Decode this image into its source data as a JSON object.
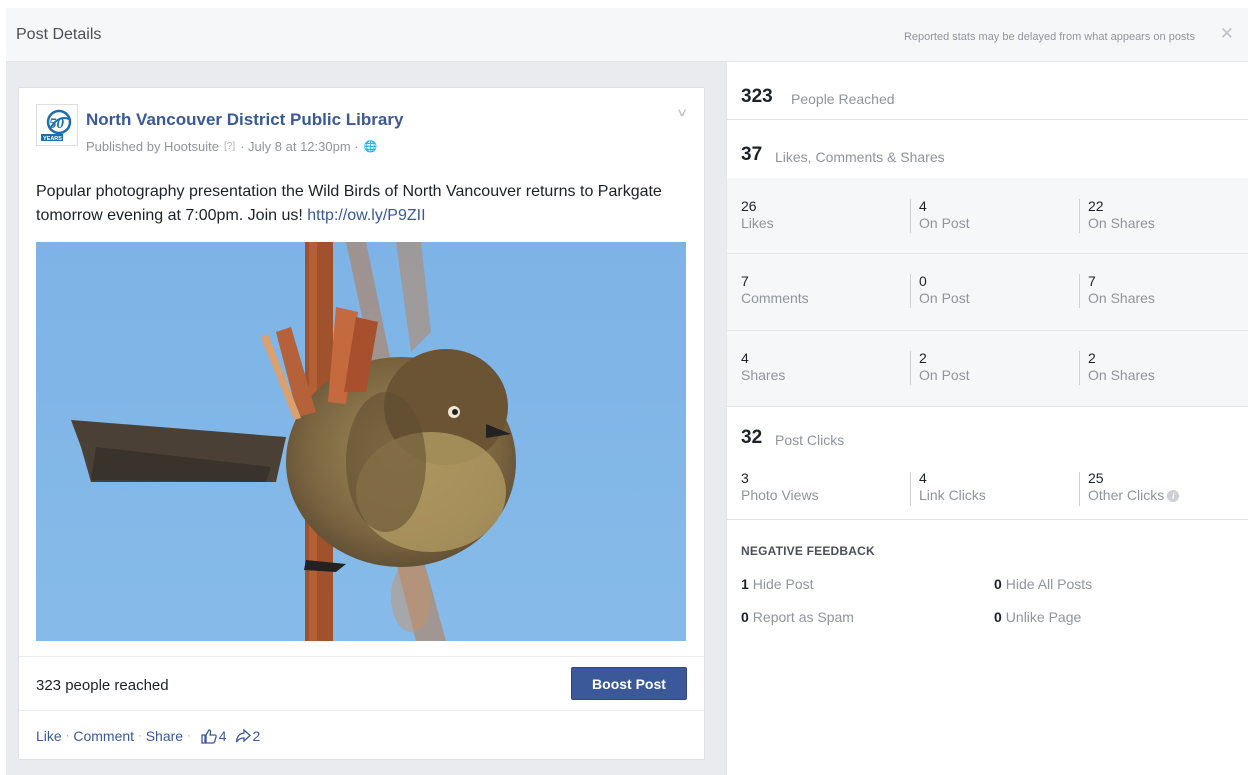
{
  "dialog": {
    "title": "Post Details",
    "note": "Reported stats may be delayed from what appears on posts",
    "close": "✕"
  },
  "post": {
    "page_name": "North Vancouver District Public Library",
    "published_by": "Published by Hootsuite",
    "help": "[?]",
    "date": "· July 8 at 12:30pm ·",
    "text": "Popular photography presentation the Wild Birds of North Vancouver returns to Parkgate tomorrow evening at 7:00pm. Join us! ",
    "link": "http://ow.ly/P9ZII",
    "reached": "323 people reached",
    "boost": "Boost Post",
    "like": "Like",
    "comment": "Comment",
    "share": "Share",
    "like_count": "4",
    "share_count": "2",
    "logo_text": "50",
    "logo_sub": "YEARS"
  },
  "stats": {
    "people_reached": {
      "value": "323",
      "label": "People Reached"
    },
    "engagement": {
      "value": "37",
      "label": "Likes, Comments & Shares"
    },
    "rows": [
      [
        {
          "n": "26",
          "l": "Likes"
        },
        {
          "n": "4",
          "l": "On Post"
        },
        {
          "n": "22",
          "l": "On Shares"
        }
      ],
      [
        {
          "n": "7",
          "l": "Comments"
        },
        {
          "n": "0",
          "l": "On Post"
        },
        {
          "n": "7",
          "l": "On Shares"
        }
      ],
      [
        {
          "n": "4",
          "l": "Shares"
        },
        {
          "n": "2",
          "l": "On Post"
        },
        {
          "n": "2",
          "l": "On Shares"
        }
      ]
    ],
    "post_clicks": {
      "value": "32",
      "label": "Post Clicks"
    },
    "clicks": [
      {
        "n": "3",
        "l": "Photo Views"
      },
      {
        "n": "4",
        "l": "Link Clicks"
      },
      {
        "n": "25",
        "l": "Other Clicks"
      }
    ],
    "negative_header": "NEGATIVE FEEDBACK",
    "negative": [
      {
        "n": "1",
        "l": "Hide Post"
      },
      {
        "n": "0",
        "l": "Hide All Posts"
      },
      {
        "n": "0",
        "l": "Report as Spam"
      },
      {
        "n": "0",
        "l": "Unlike Page"
      }
    ]
  }
}
